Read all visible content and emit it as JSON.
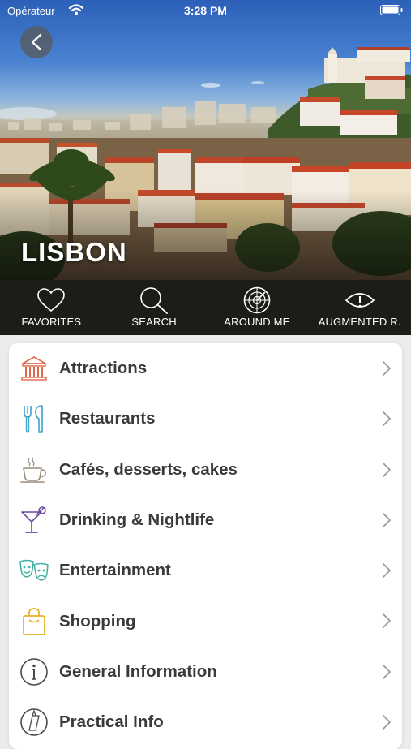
{
  "status_bar": {
    "carrier": "Opérateur",
    "time": "3:28 PM"
  },
  "hero": {
    "city": "LISBON"
  },
  "actions": [
    {
      "label": "FAVORITES",
      "icon": "heart-icon"
    },
    {
      "label": "SEARCH",
      "icon": "search-icon"
    },
    {
      "label": "AROUND ME",
      "icon": "radar-icon"
    },
    {
      "label": "AUGMENTED R.",
      "icon": "eye-icon"
    }
  ],
  "menu": [
    {
      "label": "Attractions",
      "icon": "monument-icon",
      "color": "#e0674a"
    },
    {
      "label": "Restaurants",
      "icon": "fork-knife-icon",
      "color": "#3ea3c8"
    },
    {
      "label": "Cafés, desserts, cakes",
      "icon": "coffee-cup-icon",
      "color": "#9a8c7c"
    },
    {
      "label": "Drinking & Nightlife",
      "icon": "cocktail-icon",
      "color": "#6a4aa0"
    },
    {
      "label": "Entertainment",
      "icon": "theater-masks-icon",
      "color": "#3fb0a0"
    },
    {
      "label": "Shopping",
      "icon": "shopping-bag-icon",
      "color": "#e8b020"
    },
    {
      "label": "General Information",
      "icon": "info-icon",
      "color": "#4a4a4a"
    },
    {
      "label": "Practical Info",
      "icon": "compass-icon",
      "color": "#4a4a4a"
    }
  ]
}
